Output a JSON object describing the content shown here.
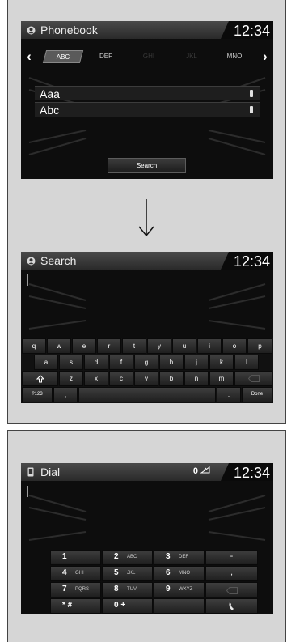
{
  "phonebook_screen": {
    "title": "Phonebook",
    "clock": "12:34",
    "tabs": [
      "ABC",
      "DEF",
      "GHI",
      "JKL",
      "MNO"
    ],
    "contacts": [
      "Aaa",
      "Abc"
    ],
    "search_button": "Search"
  },
  "search_screen": {
    "title": "Search",
    "clock": "12:34",
    "keyboard": {
      "row1": [
        "q",
        "w",
        "e",
        "r",
        "t",
        "y",
        "u",
        "i",
        "o",
        "p"
      ],
      "row2": [
        "a",
        "s",
        "d",
        "f",
        "g",
        "h",
        "j",
        "k",
        "l"
      ],
      "row3": [
        "z",
        "x",
        "c",
        "v",
        "b",
        "n",
        "m"
      ],
      "mode_key": "?123",
      "comma_key": ",",
      "period_key": ".",
      "done_key": "Done"
    }
  },
  "dial_screen": {
    "title": "Dial",
    "clock": "12:34",
    "status_indicator": "0",
    "keys": [
      {
        "num": "1",
        "letters": ""
      },
      {
        "num": "2",
        "letters": "ABC"
      },
      {
        "num": "3",
        "letters": "DEF"
      },
      {
        "num": "4",
        "letters": "GHI"
      },
      {
        "num": "5",
        "letters": "JKL"
      },
      {
        "num": "6",
        "letters": "MNO"
      },
      {
        "num": "7",
        "letters": "PQRS"
      },
      {
        "num": "8",
        "letters": "TUV"
      },
      {
        "num": "9",
        "letters": "WXYZ"
      },
      {
        "num": "* #",
        "letters": ""
      },
      {
        "num": "0 +",
        "letters": ""
      }
    ],
    "side_keys": [
      "-",
      ",",
      ""
    ]
  },
  "colors": {
    "screen_bg": "#0d0d0d",
    "titlebar": "#3a3a3a",
    "frame_bg": "#d6d6d6"
  }
}
